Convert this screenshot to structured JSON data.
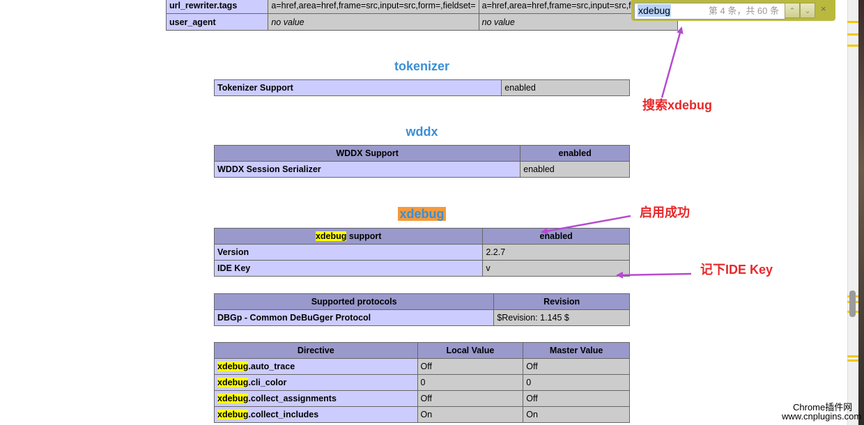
{
  "top_table": {
    "rows": [
      {
        "name": "url_rewriter.tags",
        "local": "a=href,area=href,frame=src,input=src,form=,fieldset=",
        "master": "a=href,area=href,frame=src,input=src,form="
      },
      {
        "name": "user_agent",
        "local": "no value",
        "master": "no value"
      }
    ]
  },
  "tokenizer": {
    "title": "tokenizer",
    "row": {
      "name": "Tokenizer Support",
      "value": "enabled"
    }
  },
  "wddx": {
    "title": "wddx",
    "head": {
      "name": "WDDX Support",
      "value": "enabled"
    },
    "row": {
      "name": "WDDX Session Serializer",
      "value": "enabled"
    }
  },
  "xdebug": {
    "title": "xdebug",
    "head": {
      "hl": "xdebug",
      "rest": " support",
      "value": "enabled"
    },
    "rows": [
      {
        "name": "Version",
        "value": "2.2.7"
      },
      {
        "name": "IDE Key",
        "value": "v"
      }
    ]
  },
  "protocols": {
    "head": {
      "name": "Supported protocols",
      "value": "Revision"
    },
    "row": {
      "name": "DBGp - Common DeBuGger Protocol",
      "value": "$Revision: 1.145 $"
    }
  },
  "directives": {
    "head": {
      "directive": "Directive",
      "local": "Local Value",
      "master": "Master Value"
    },
    "rows": [
      {
        "hl": "xdebug",
        "rest": ".auto_trace",
        "local": "Off",
        "master": "Off"
      },
      {
        "hl": "xdebug",
        "rest": ".cli_color",
        "local": "0",
        "master": "0"
      },
      {
        "hl": "xdebug",
        "rest": ".collect_assignments",
        "local": "Off",
        "master": "Off"
      },
      {
        "hl": "xdebug",
        "rest": ".collect_includes",
        "local": "On",
        "master": "On"
      }
    ]
  },
  "findbar": {
    "query": "xdebug",
    "count": "第 4 条，共 60 条",
    "prev_icon": "chevron-up-icon",
    "next_icon": "chevron-down-icon",
    "close_icon": "close-icon",
    "close_glyph": "×",
    "prev_glyph": "⌃",
    "next_glyph": "⌄"
  },
  "annotations": {
    "search": "搜索xdebug",
    "enabled": "启用成功",
    "idekey": "记下IDE Key",
    "color": "#e8282a",
    "arrow_color": "#b64ad0"
  },
  "watermark": {
    "line1": "Chrome插件网",
    "line2": "www.cnplugins.com"
  }
}
